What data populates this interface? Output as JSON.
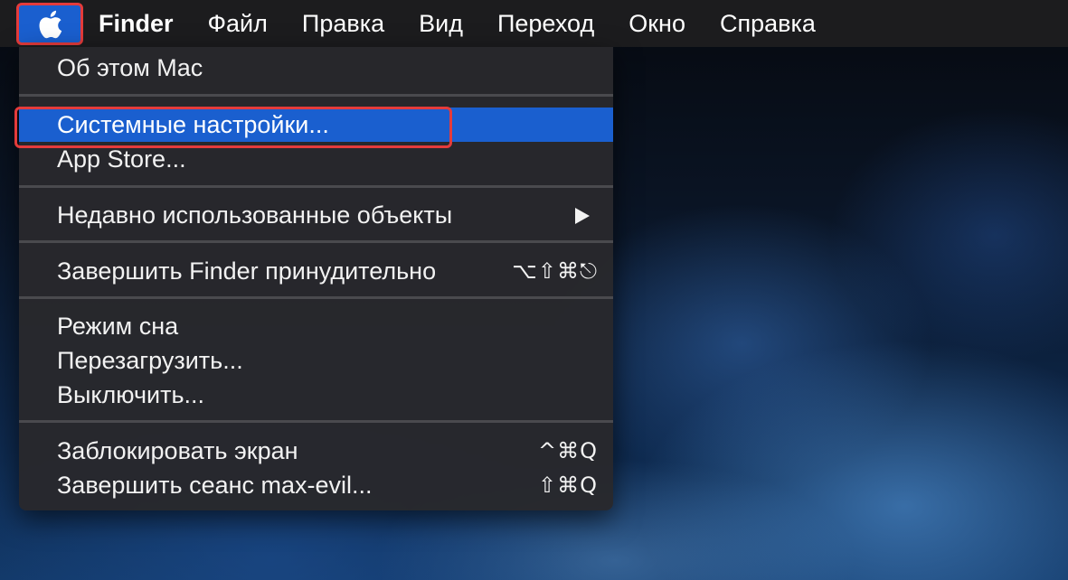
{
  "menubar": {
    "apple_icon": "apple-logo-icon",
    "app_name": "Finder",
    "items": [
      "Файл",
      "Правка",
      "Вид",
      "Переход",
      "Окно",
      "Справка"
    ]
  },
  "apple_menu": {
    "about": "Об этом Mac",
    "system_prefs": "Системные настройки...",
    "app_store": "App Store...",
    "recent_items": "Недавно использованные объекты",
    "force_quit": "Завершить Finder принудительно",
    "force_quit_shortcut": "⌥⇧⌘⎋",
    "sleep": "Режим сна",
    "restart": "Перезагрузить...",
    "shutdown": "Выключить...",
    "lock_screen": "Заблокировать экран",
    "lock_screen_shortcut": "^⌘Q",
    "log_out": "Завершить сеанс max-evil...",
    "log_out_shortcut": "⇧⌘Q"
  },
  "colors": {
    "selection": "#1a5fcf",
    "highlight_annotation": "#e43b3b",
    "menubar_bg": "#1c1c1e",
    "menu_bg": "#28282c"
  }
}
